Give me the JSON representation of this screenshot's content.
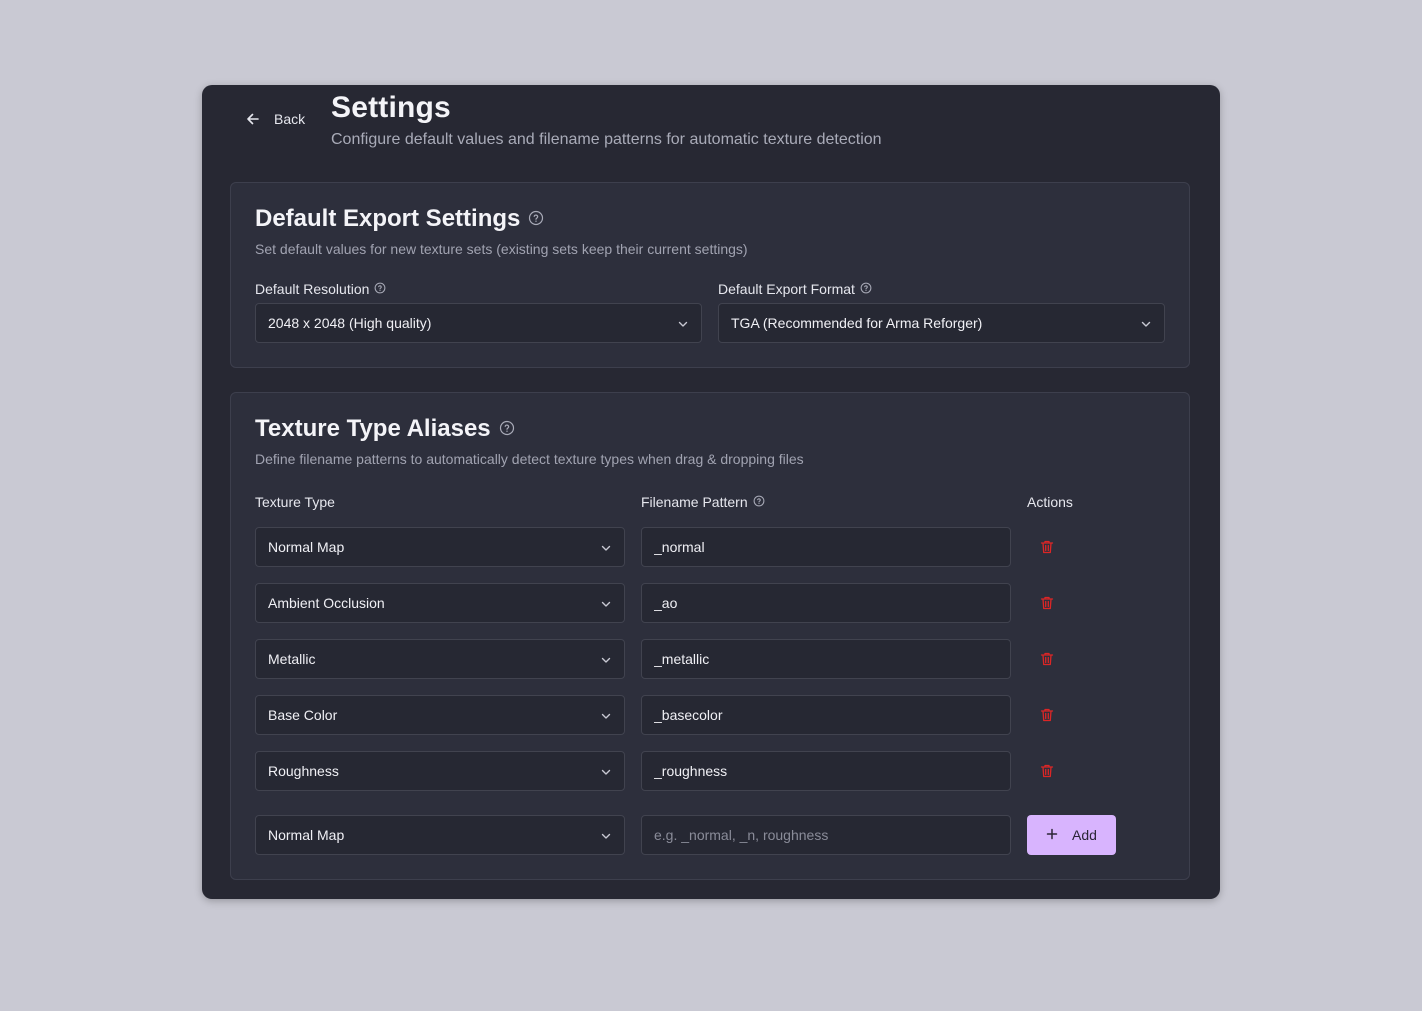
{
  "header": {
    "back_label": "Back",
    "title": "Settings",
    "subtitle": "Configure default values and filename patterns for automatic texture detection"
  },
  "export_settings": {
    "title": "Default Export Settings",
    "description": "Set default values for new texture sets (existing sets keep their current settings)",
    "resolution_label": "Default Resolution",
    "resolution_value": "2048 x 2048 (High quality)",
    "format_label": "Default Export Format",
    "format_value": "TGA (Recommended for Arma Reforger)"
  },
  "aliases": {
    "title": "Texture Type Aliases",
    "description": "Define filename patterns to automatically detect texture types when drag & dropping files",
    "columns": {
      "texture_type": "Texture Type",
      "filename_pattern": "Filename Pattern",
      "actions": "Actions"
    },
    "rows": [
      {
        "type": "Normal Map",
        "pattern": "_normal"
      },
      {
        "type": "Ambient Occlusion",
        "pattern": "_ao"
      },
      {
        "type": "Metallic",
        "pattern": "_metallic"
      },
      {
        "type": "Base Color",
        "pattern": "_basecolor"
      },
      {
        "type": "Roughness",
        "pattern": "_roughness"
      }
    ],
    "new_row": {
      "type": "Normal Map",
      "pattern_value": "",
      "pattern_placeholder": "e.g. _normal, _n, roughness",
      "add_label": "Add"
    }
  },
  "colors": {
    "accent": "#d8b4fe",
    "danger": "#dc2626",
    "background": "#c9c9d3",
    "panel": "#272833",
    "card": "#2d2f3c"
  }
}
